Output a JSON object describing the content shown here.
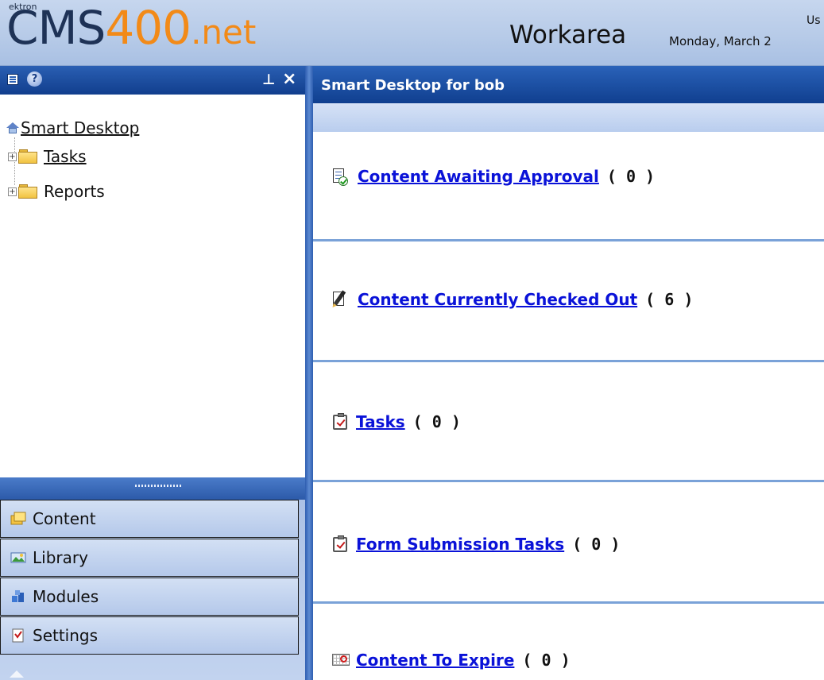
{
  "banner": {
    "logo_small": "ektron",
    "logo_cms": "CMS",
    "logo_400": "400",
    "logo_net": ".net",
    "title": "Workarea",
    "date": "Monday, March 2",
    "user_fragment": "Us"
  },
  "left_pane": {
    "pin_glyph": "ᵖ",
    "close_glyph": "×",
    "tree": {
      "root": "Smart Desktop",
      "items": [
        {
          "label": "Tasks"
        },
        {
          "label": "Reports"
        }
      ]
    },
    "accordion": [
      {
        "label": "Content",
        "icon": "content-icon"
      },
      {
        "label": "Library",
        "icon": "library-icon"
      },
      {
        "label": "Modules",
        "icon": "modules-icon"
      },
      {
        "label": "Settings",
        "icon": "settings-icon"
      }
    ]
  },
  "right_pane": {
    "title": "Smart Desktop for bob",
    "rows": [
      {
        "label": "Content Awaiting Approval",
        "count": "( 0 )",
        "icon": "approval-icon"
      },
      {
        "label": "Content Currently Checked Out",
        "count": "( 6 )",
        "icon": "checked-out-icon"
      },
      {
        "label": "Tasks",
        "count": "( 0 )",
        "icon": "task-icon"
      },
      {
        "label": "Form Submission Tasks",
        "count": "( 0 )",
        "icon": "form-task-icon"
      },
      {
        "label": "Content To Expire",
        "count": "( 0 )",
        "icon": "expire-icon"
      }
    ]
  },
  "colors": {
    "header_blue": "#1a4a9e",
    "link_blue": "#0a12d8",
    "logo_orange": "#f28a18"
  }
}
